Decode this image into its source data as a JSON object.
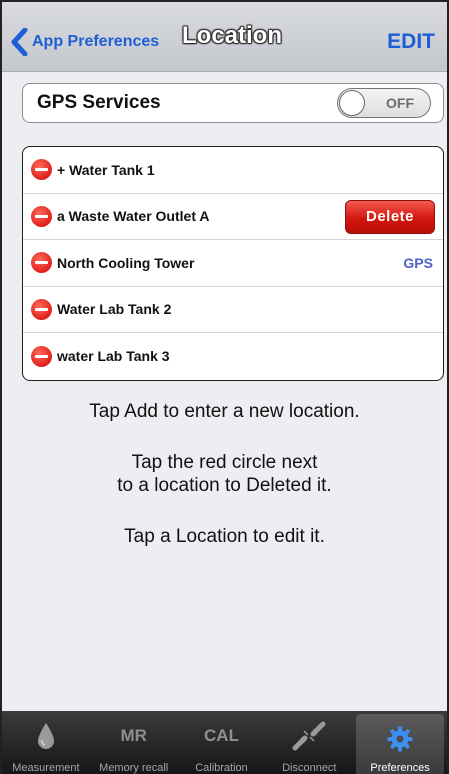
{
  "navbar": {
    "back_label": "App Preferences",
    "title": "Location",
    "edit_label": "EDIT"
  },
  "gps": {
    "label": "GPS Services",
    "toggle_state": "OFF"
  },
  "locations": [
    {
      "name": "+ Water Tank 1"
    },
    {
      "name": "a Waste Water Outlet A",
      "action": "Delete"
    },
    {
      "name": "North Cooling Tower",
      "tag": "GPS"
    },
    {
      "name": "Water Lab Tank 2"
    },
    {
      "name": "water Lab Tank 3"
    }
  ],
  "instructions": {
    "line1": "Tap Add to enter a new location.",
    "line2a": "Tap the red circle next",
    "line2b": "to a location to Deleted it.",
    "line3": "Tap a Location to edit it."
  },
  "tabbar": {
    "tabs": [
      {
        "label": "Measurement",
        "icon": "drop-icon"
      },
      {
        "label": "Memory recall",
        "icon_text": "MR"
      },
      {
        "label": "Calibration",
        "icon_text": "CAL"
      },
      {
        "label": "Disconnect",
        "icon": "disconnect-icon"
      },
      {
        "label": "Preferences",
        "icon": "gear-icon",
        "active": true
      }
    ]
  },
  "colors": {
    "accent": "#1f5fd6",
    "delete": "#d1160f",
    "gps_tag": "#4b63c9",
    "gear": "#3d8ff0"
  }
}
